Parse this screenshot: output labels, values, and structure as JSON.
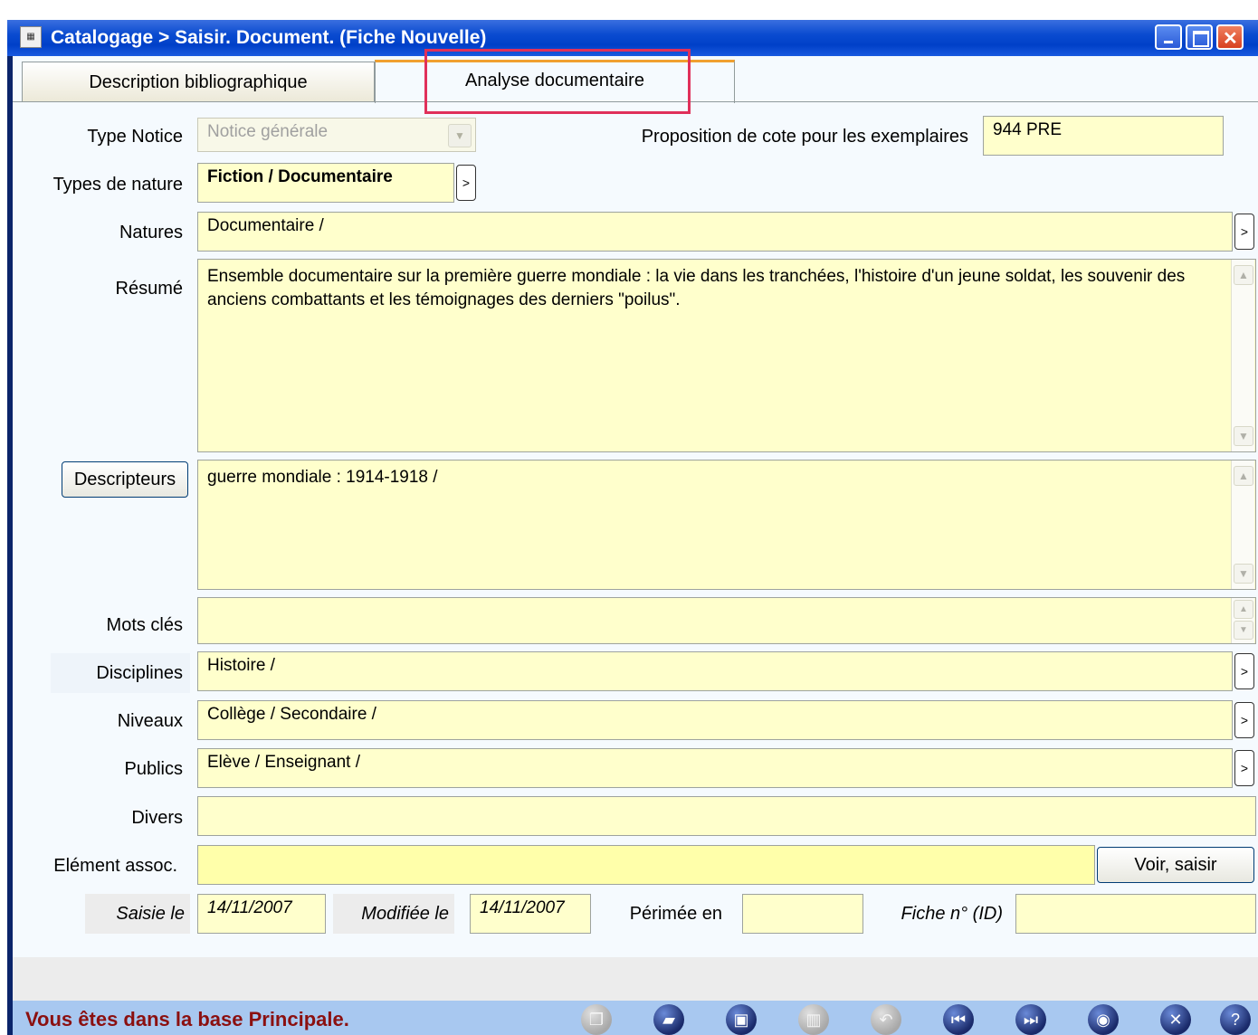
{
  "window": {
    "title": "Catalogage > Saisir. Document.  (Fiche Nouvelle)",
    "app_icon": "catalog-app-icon",
    "controls": [
      "minimize-icon",
      "maximize-icon",
      "close-icon"
    ]
  },
  "tabs": [
    {
      "label": "Description bibliographique",
      "active": false
    },
    {
      "label": "Analyse documentaire",
      "active": true
    }
  ],
  "highlight_color": "#e0305a",
  "form": {
    "type_notice": {
      "label": "Type Notice",
      "value": "Notice générale"
    },
    "cote": {
      "label": "Proposition de cote pour  les exemplaires",
      "value": "944 PRE"
    },
    "types_nature": {
      "label": "Types de nature",
      "value": "Fiction / Documentaire",
      "button": ">"
    },
    "natures": {
      "label": "Natures",
      "value": "Documentaire /",
      "button": ">"
    },
    "resume": {
      "label": "Résumé",
      "value": "Ensemble documentaire sur la première guerre mondiale : la vie dans les tranchées, l'histoire d'un jeune soldat, les souvenir des anciens combattants et les témoignages des derniers \"poilus\"."
    },
    "descripteurs": {
      "button": "Descripteurs",
      "value": "guerre mondiale : 1914-1918 /"
    },
    "mots_cles": {
      "label": "Mots clés",
      "value": ""
    },
    "disciplines": {
      "label": "Disciplines",
      "value": "Histoire /",
      "button": ">"
    },
    "niveaux": {
      "label": "Niveaux",
      "value": "Collège / Secondaire /",
      "button": ">"
    },
    "publics": {
      "label": "Publics",
      "value": "Elève / Enseignant /",
      "button": ">"
    },
    "divers": {
      "label": "Divers",
      "value": ""
    },
    "element_assoc": {
      "label": "Elément assoc.",
      "value": "",
      "button": "Voir, saisir"
    },
    "saisie": {
      "label": "Saisie le",
      "value": "14/11/2007"
    },
    "modifiee": {
      "label": "Modifiée le",
      "value": "14/11/2007"
    },
    "perimee": {
      "label": "Périmée en",
      "value": ""
    },
    "fiche": {
      "label": "Fiche n° (ID)",
      "value": ""
    }
  },
  "status": {
    "message": "Vous êtes dans la base Principale.",
    "message_color": "#8b1010",
    "toolbar": [
      {
        "icon": "copy-icon",
        "enabled": false
      },
      {
        "icon": "new-document-icon",
        "enabled": true
      },
      {
        "icon": "save-icon",
        "enabled": true
      },
      {
        "icon": "trash-icon",
        "enabled": false
      },
      {
        "icon": "undo-icon",
        "enabled": false
      },
      {
        "icon": "first-record-icon",
        "enabled": true
      },
      {
        "icon": "last-record-icon",
        "enabled": true
      },
      {
        "icon": "eye-icon",
        "enabled": true
      },
      {
        "icon": "close-circle-icon",
        "enabled": true
      },
      {
        "icon": "help-icon",
        "enabled": true
      }
    ]
  }
}
